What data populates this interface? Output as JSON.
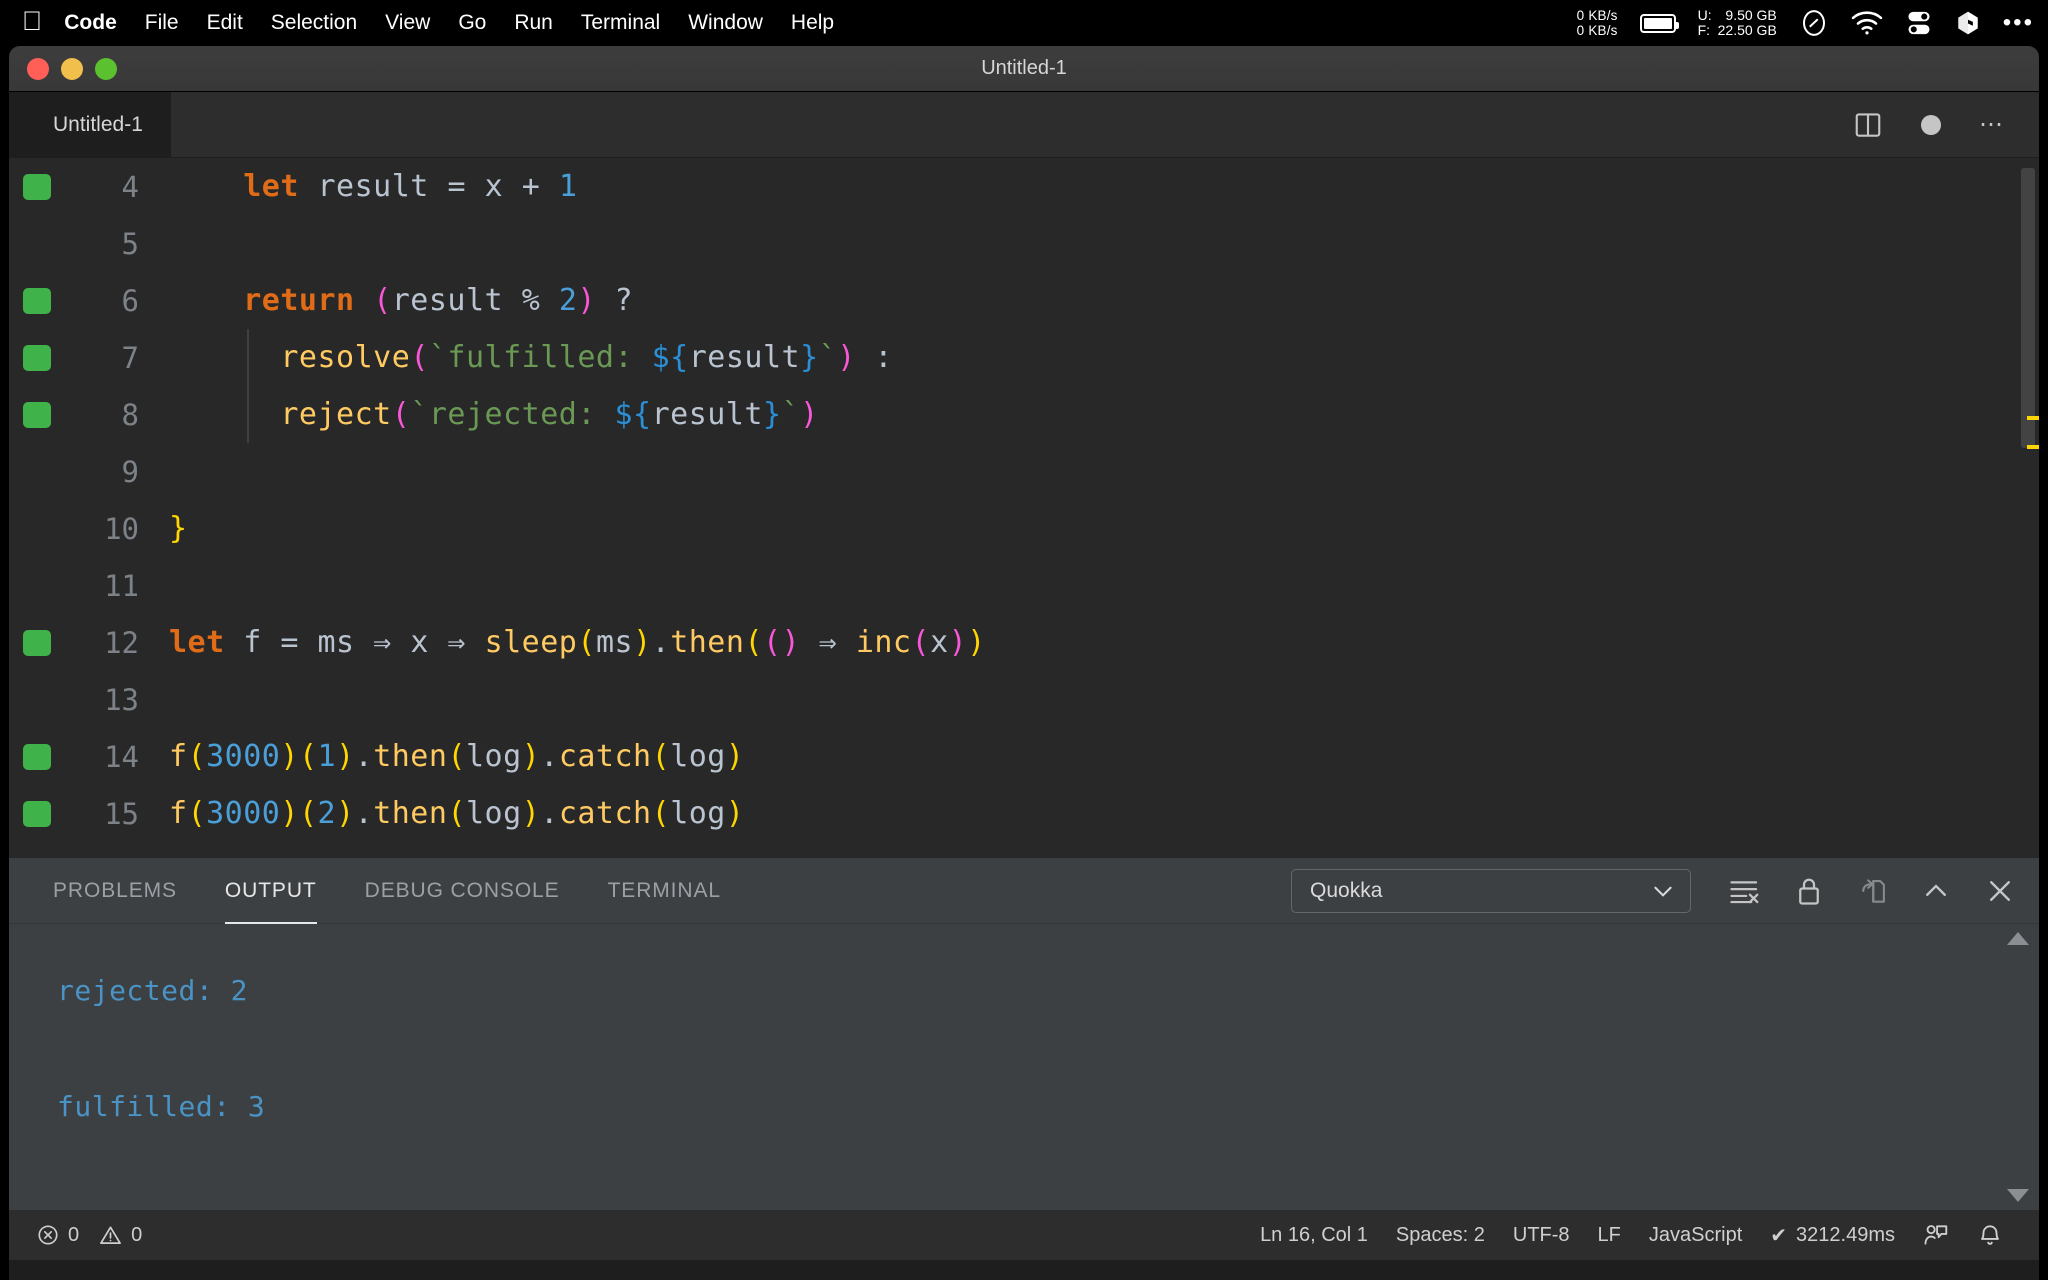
{
  "menubar": {
    "apple_glyph": "apple-logo-icon",
    "items": [
      {
        "label": "Code",
        "bold": true
      },
      {
        "label": "File",
        "bold": false
      },
      {
        "label": "Edit",
        "bold": false
      },
      {
        "label": "Selection",
        "bold": false
      },
      {
        "label": "View",
        "bold": false
      },
      {
        "label": "Go",
        "bold": false
      },
      {
        "label": "Run",
        "bold": false
      },
      {
        "label": "Terminal",
        "bold": false
      },
      {
        "label": "Window",
        "bold": false
      },
      {
        "label": "Help",
        "bold": false
      }
    ],
    "status": {
      "net_up": "0 KB/s",
      "net_down": "0 KB/s",
      "mem_used_label": "U:",
      "mem_used_value": "9.50 GB",
      "mem_free_label": "F:",
      "mem_free_value": "22.50 GB",
      "extra_dots": "•••"
    }
  },
  "window": {
    "title": "Untitled-1"
  },
  "tabbar": {
    "tab_label": "Untitled-1"
  },
  "editor": {
    "indent_guide_lines": [
      7,
      8
    ],
    "lines": [
      {
        "number": "4",
        "covered": true,
        "tokens": [
          {
            "t": "    ",
            "c": "punct"
          },
          {
            "t": "let",
            "c": "kw"
          },
          {
            "t": " ",
            "c": "punct"
          },
          {
            "t": "result",
            "c": "var"
          },
          {
            "t": " ",
            "c": "punct"
          },
          {
            "t": "=",
            "c": "op"
          },
          {
            "t": " ",
            "c": "punct"
          },
          {
            "t": "x",
            "c": "var"
          },
          {
            "t": " ",
            "c": "punct"
          },
          {
            "t": "+",
            "c": "op"
          },
          {
            "t": " ",
            "c": "punct"
          },
          {
            "t": "1",
            "c": "num"
          }
        ]
      },
      {
        "number": "5",
        "covered": false,
        "tokens": []
      },
      {
        "number": "6",
        "covered": true,
        "tokens": [
          {
            "t": "    ",
            "c": "punct"
          },
          {
            "t": "return",
            "c": "kw"
          },
          {
            "t": " ",
            "c": "punct"
          },
          {
            "t": "(",
            "c": "br2"
          },
          {
            "t": "result",
            "c": "var"
          },
          {
            "t": " ",
            "c": "punct"
          },
          {
            "t": "%",
            "c": "op"
          },
          {
            "t": " ",
            "c": "punct"
          },
          {
            "t": "2",
            "c": "num"
          },
          {
            "t": ")",
            "c": "br2"
          },
          {
            "t": " ?",
            "c": "punct"
          }
        ]
      },
      {
        "number": "7",
        "covered": true,
        "tokens": [
          {
            "t": "      ",
            "c": "punct"
          },
          {
            "t": "resolve",
            "c": "fn"
          },
          {
            "t": "(",
            "c": "br2"
          },
          {
            "t": "`fulfilled: ",
            "c": "str"
          },
          {
            "t": "${",
            "c": "tpl"
          },
          {
            "t": "result",
            "c": "var"
          },
          {
            "t": "}",
            "c": "tpl"
          },
          {
            "t": "`",
            "c": "str"
          },
          {
            "t": ")",
            "c": "br2"
          },
          {
            "t": " :",
            "c": "punct"
          }
        ]
      },
      {
        "number": "8",
        "covered": true,
        "tokens": [
          {
            "t": "      ",
            "c": "punct"
          },
          {
            "t": "reject",
            "c": "fn"
          },
          {
            "t": "(",
            "c": "br2"
          },
          {
            "t": "`rejected: ",
            "c": "str"
          },
          {
            "t": "${",
            "c": "tpl"
          },
          {
            "t": "result",
            "c": "var"
          },
          {
            "t": "}",
            "c": "tpl"
          },
          {
            "t": "`",
            "c": "str"
          },
          {
            "t": ")",
            "c": "br2"
          }
        ]
      },
      {
        "number": "9",
        "covered": false,
        "tokens": []
      },
      {
        "number": "10",
        "covered": false,
        "tokens": [
          {
            "t": "}",
            "c": "br1"
          }
        ]
      },
      {
        "number": "11",
        "covered": false,
        "tokens": []
      },
      {
        "number": "12",
        "covered": true,
        "tokens": [
          {
            "t": "let",
            "c": "kw"
          },
          {
            "t": " ",
            "c": "punct"
          },
          {
            "t": "f",
            "c": "var"
          },
          {
            "t": " ",
            "c": "punct"
          },
          {
            "t": "=",
            "c": "op"
          },
          {
            "t": " ",
            "c": "punct"
          },
          {
            "t": "ms",
            "c": "var"
          },
          {
            "t": " ⇒ ",
            "c": "op"
          },
          {
            "t": "x",
            "c": "var"
          },
          {
            "t": " ⇒ ",
            "c": "op"
          },
          {
            "t": "sleep",
            "c": "fn"
          },
          {
            "t": "(",
            "c": "br1"
          },
          {
            "t": "ms",
            "c": "var"
          },
          {
            "t": ")",
            "c": "br1"
          },
          {
            "t": ".",
            "c": "punct"
          },
          {
            "t": "then",
            "c": "fn"
          },
          {
            "t": "(",
            "c": "br1"
          },
          {
            "t": "(",
            "c": "br2"
          },
          {
            "t": ")",
            "c": "br2"
          },
          {
            "t": " ⇒ ",
            "c": "op"
          },
          {
            "t": "inc",
            "c": "fn"
          },
          {
            "t": "(",
            "c": "br2"
          },
          {
            "t": "x",
            "c": "var"
          },
          {
            "t": ")",
            "c": "br2"
          },
          {
            "t": ")",
            "c": "br1"
          }
        ]
      },
      {
        "number": "13",
        "covered": false,
        "tokens": []
      },
      {
        "number": "14",
        "covered": true,
        "tokens": [
          {
            "t": "f",
            "c": "fn"
          },
          {
            "t": "(",
            "c": "br1"
          },
          {
            "t": "3000",
            "c": "num"
          },
          {
            "t": ")",
            "c": "br1"
          },
          {
            "t": "(",
            "c": "br1"
          },
          {
            "t": "1",
            "c": "num"
          },
          {
            "t": ")",
            "c": "br1"
          },
          {
            "t": ".",
            "c": "punct"
          },
          {
            "t": "then",
            "c": "fn"
          },
          {
            "t": "(",
            "c": "br1"
          },
          {
            "t": "log",
            "c": "var"
          },
          {
            "t": ")",
            "c": "br1"
          },
          {
            "t": ".",
            "c": "punct"
          },
          {
            "t": "catch",
            "c": "fn"
          },
          {
            "t": "(",
            "c": "br1"
          },
          {
            "t": "log",
            "c": "var"
          },
          {
            "t": ")",
            "c": "br1"
          }
        ]
      },
      {
        "number": "15",
        "covered": true,
        "tokens": [
          {
            "t": "f",
            "c": "fn"
          },
          {
            "t": "(",
            "c": "br1"
          },
          {
            "t": "3000",
            "c": "num"
          },
          {
            "t": ")",
            "c": "br1"
          },
          {
            "t": "(",
            "c": "br1"
          },
          {
            "t": "2",
            "c": "num"
          },
          {
            "t": ")",
            "c": "br1"
          },
          {
            "t": ".",
            "c": "punct"
          },
          {
            "t": "then",
            "c": "fn"
          },
          {
            "t": "(",
            "c": "br1"
          },
          {
            "t": "log",
            "c": "var"
          },
          {
            "t": ")",
            "c": "br1"
          },
          {
            "t": ".",
            "c": "punct"
          },
          {
            "t": "catch",
            "c": "fn"
          },
          {
            "t": "(",
            "c": "br1"
          },
          {
            "t": "log",
            "c": "var"
          },
          {
            "t": ")",
            "c": "br1"
          }
        ]
      }
    ]
  },
  "panel": {
    "tabs": [
      {
        "label": "PROBLEMS",
        "active": false
      },
      {
        "label": "OUTPUT",
        "active": true
      },
      {
        "label": "DEBUG CONSOLE",
        "active": false
      },
      {
        "label": "TERMINAL",
        "active": false
      }
    ],
    "channel_select": {
      "value": "Quokka"
    },
    "actions": [
      "clear-output-icon",
      "lock-scroll-icon",
      "open-in-editor-icon",
      "maximize-panel-icon",
      "close-panel-icon"
    ],
    "output_lines": [
      "rejected: 2",
      "",
      "fulfilled: 3"
    ]
  },
  "statusbar": {
    "errors": "0",
    "warnings": "0",
    "cursor": "Ln 16, Col 1",
    "indentation": "Spaces: 2",
    "encoding": "UTF-8",
    "eol": "LF",
    "language": "JavaScript",
    "quokka_time": "3212.49ms",
    "quokka_check": "✔"
  },
  "colors": {
    "coverage_green": "#3fb24a",
    "output_text_blue": "#4a93c4",
    "keyword_orange": "#e06c18",
    "function_yellow": "#ffca62",
    "string_green": "#6a9955",
    "bracket_yellow": "#ffd600",
    "bracket_magenta": "#f957d8",
    "number_blue": "#4a9fd8"
  }
}
